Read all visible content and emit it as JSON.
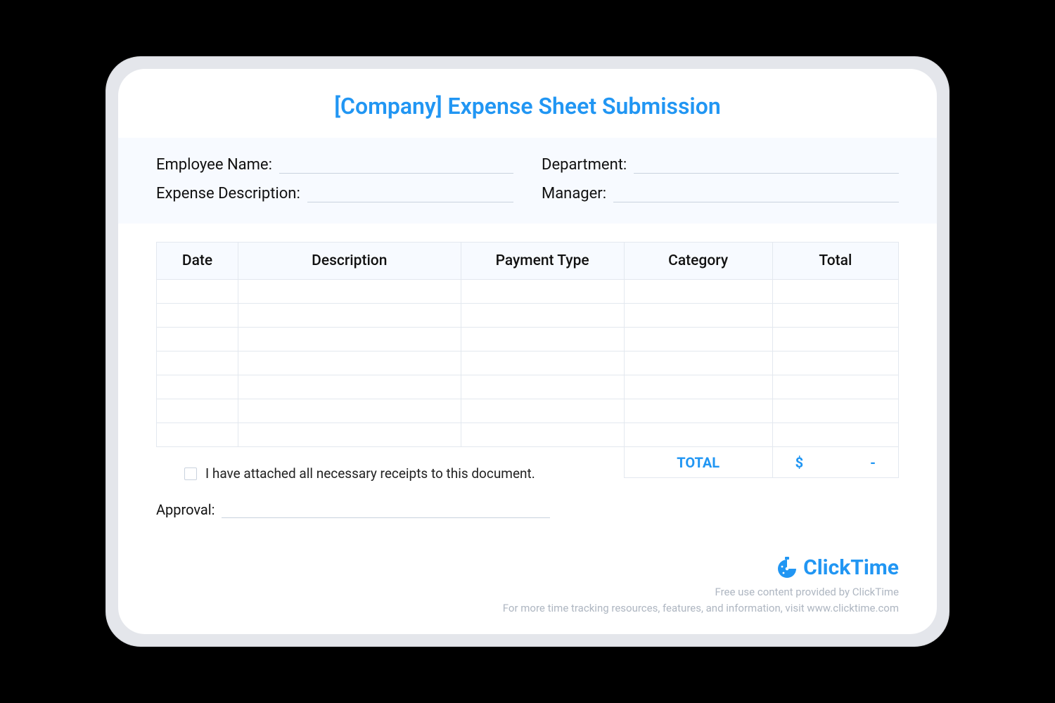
{
  "title": "[Company] Expense Sheet Submission",
  "fields": {
    "employee_name": "Employee Name:",
    "department": "Department:",
    "expense_description": "Expense Description:",
    "manager": "Manager:"
  },
  "columns": {
    "date": "Date",
    "description": "Description",
    "payment_type": "Payment Type",
    "category": "Category",
    "total": "Total"
  },
  "rows": [
    "",
    "",
    "",
    "",
    "",
    "",
    ""
  ],
  "total_label": "TOTAL",
  "total_currency": "$",
  "total_value": "-",
  "attestation": "I have attached all necessary receipts to this document.",
  "approval_label": "Approval:",
  "brand": "ClickTime",
  "footnote1": "Free use content provided by ClickTime",
  "footnote2": "For more time tracking resources, features, and information, visit www.clicktime.com"
}
